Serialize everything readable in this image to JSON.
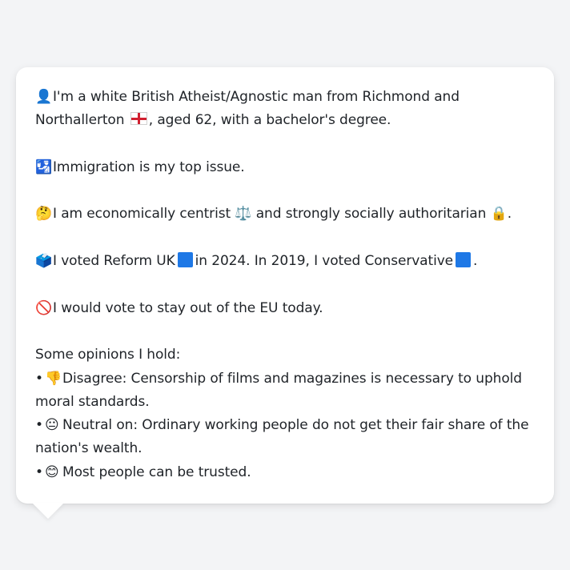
{
  "profile": {
    "identity_1": "I'm a white British Atheist/Agnostic man from Richmond and",
    "identity_2a": "Northallerton",
    "identity_2b": ", aged 62, with a bachelor's degree.",
    "top_issue": "Immigration is my top issue.",
    "econ_a": "I am economically centrist",
    "econ_b": "and strongly socially authoritarian",
    "econ_c": ".",
    "vote_a": "I voted Reform UK",
    "vote_b": "in 2024. In 2019, I voted Conservative",
    "vote_c": ".",
    "eu": "I would vote to stay out of the EU today.",
    "opinions_heading": "Some opinions I hold:",
    "opinions": [
      {
        "bullet": "•",
        "line1": "Disagree: Censorship of films and magazines is necessary to uphold",
        "line2": "moral standards."
      },
      {
        "bullet": "•",
        "line1": "Neutral on: Ordinary working people do not get their fair share of the",
        "line2": "nation's wealth."
      },
      {
        "bullet": "•",
        "line1": "Most people can be trusted.",
        "line2": ""
      }
    ]
  },
  "icons": {
    "person": "👤",
    "issue": "🛂",
    "thinking": "🤔",
    "scales": "⚖️",
    "lock": "🔒",
    "ballot": "🗳️",
    "no": "🚫",
    "thumbs_down": "👎",
    "neutral_face": "😐",
    "smile": "😊"
  },
  "colors": {
    "party_square": "#1e78e6",
    "card_bg": "#ffffff",
    "page_bg": "#f3f4f6"
  }
}
